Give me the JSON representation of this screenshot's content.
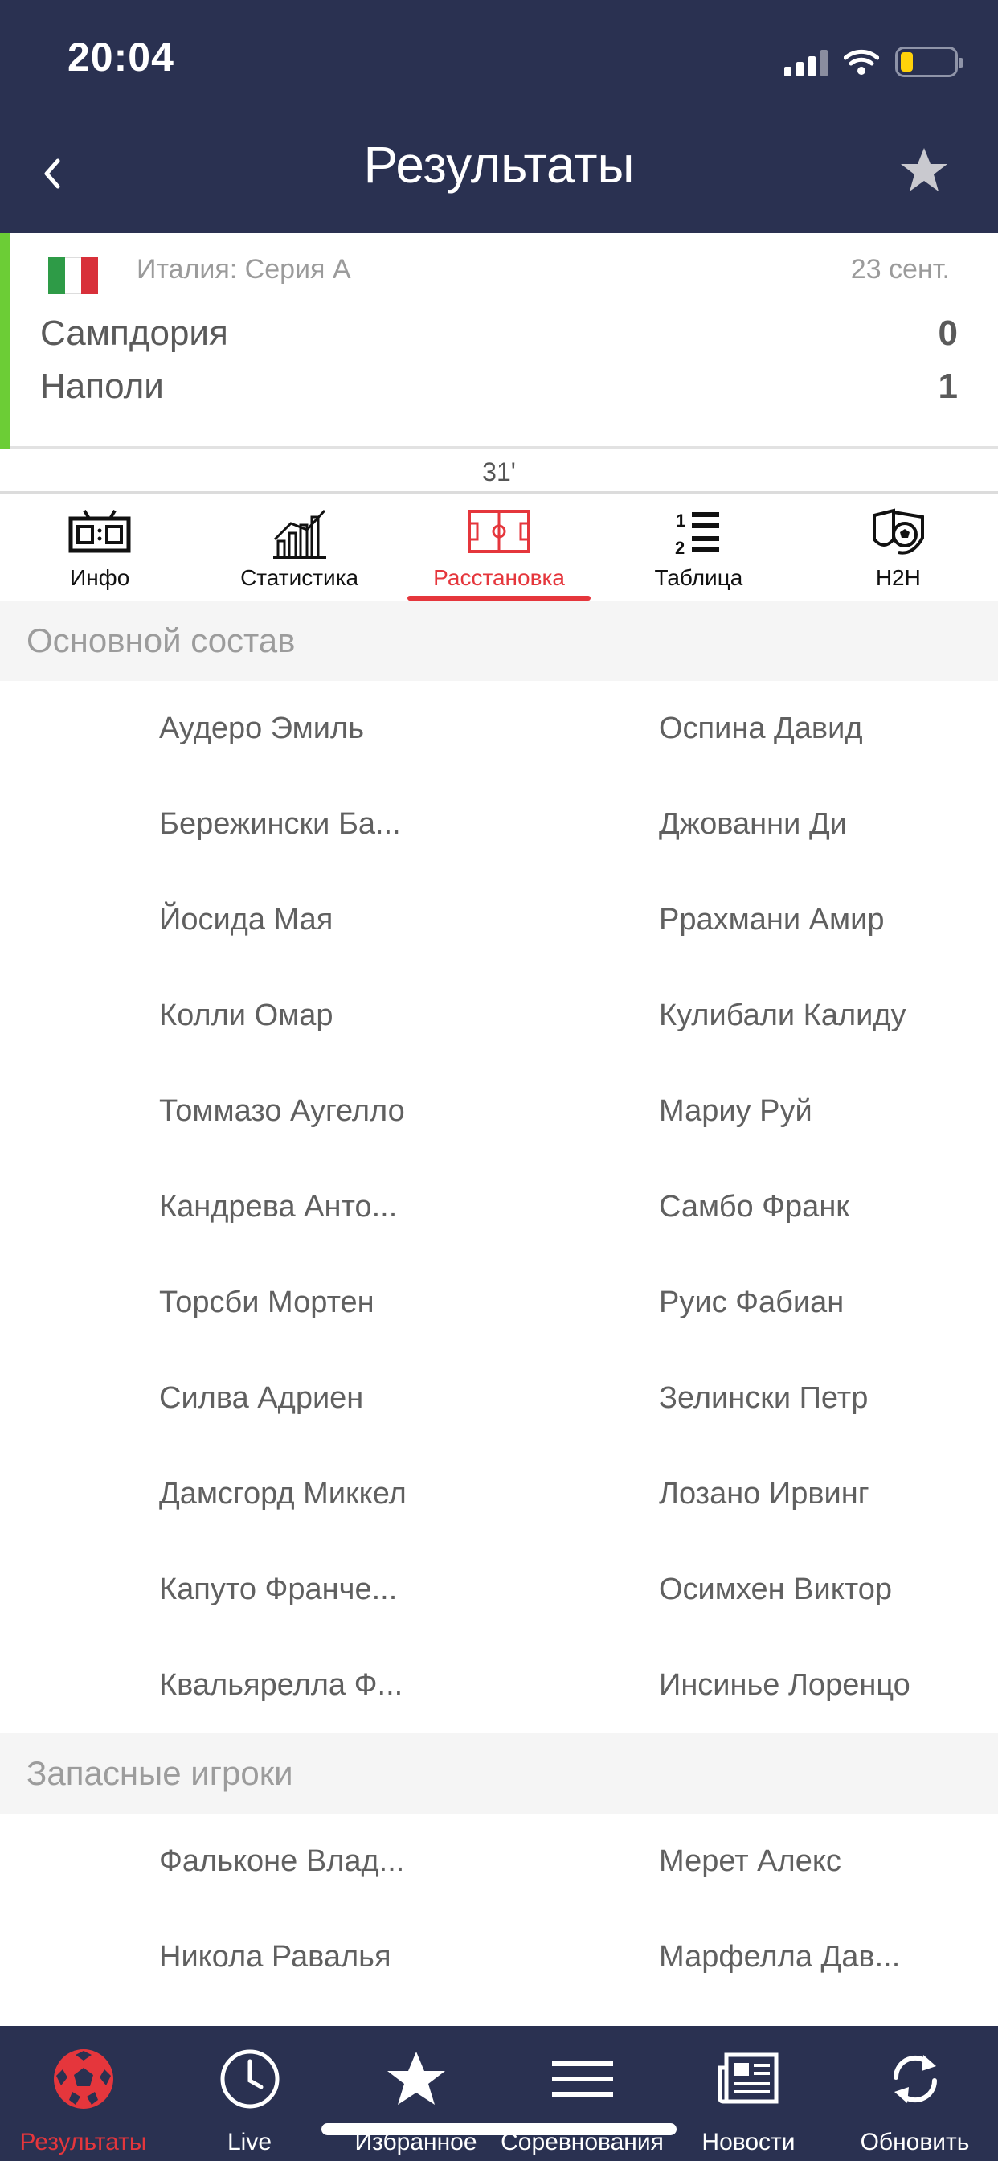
{
  "status_bar": {
    "time": "20:04"
  },
  "header": {
    "title": "Результаты"
  },
  "match": {
    "league": "Италия: Серия А",
    "date": "23 сент.",
    "home_team": "Сампдория",
    "away_team": "Наполи",
    "home_score": "0",
    "away_score": "1",
    "minute": "31'",
    "flag_colors": [
      "#2e9b47",
      "#ffffff",
      "#d8303a"
    ],
    "live_color": "#6ccd36"
  },
  "tabs": [
    {
      "label": "Инфо",
      "icon": "scoreboard-icon"
    },
    {
      "label": "Статистика",
      "icon": "stats-chart-icon"
    },
    {
      "label": "Расстановка",
      "icon": "field-lineup-icon",
      "active": true
    },
    {
      "label": "Таблица",
      "icon": "standings-list-icon"
    },
    {
      "label": "H2H",
      "icon": "h2h-shield-icon"
    }
  ],
  "lineups": {
    "starting_title": "Основной состав",
    "starting": [
      {
        "home": "Аудеро Эмиль",
        "away": "Оспина Давид"
      },
      {
        "home": "Бережински Ба...",
        "away": "Джованни Ди"
      },
      {
        "home": "Йосида Мая",
        "away": "Ррахмани Амир"
      },
      {
        "home": "Колли Омар",
        "away": "Кулибали Калиду"
      },
      {
        "home": "Томмазо Аугелло",
        "away": "Мариу Руй"
      },
      {
        "home": "Кандрева Анто...",
        "away": "Самбо Франк"
      },
      {
        "home": "Торсби Мортен",
        "away": "Руис Фабиан"
      },
      {
        "home": "Силва Адриен",
        "away": "Зелински Петр"
      },
      {
        "home": "Дамсгорд Миккел",
        "away": "Лозано Ирвинг"
      },
      {
        "home": "Капуто Франче...",
        "away": "Осимхен Виктор"
      },
      {
        "home": "Квальярелла Ф...",
        "away": "Инсинье Лоренцо"
      }
    ],
    "subs_title": "Запасные игроки",
    "subs": [
      {
        "home": "Фальконе Влад...",
        "away": "Мерет Алекс"
      },
      {
        "home": "Никола Равалья",
        "away": "Марфелла Дав..."
      }
    ]
  },
  "bottom_nav": [
    {
      "label": "Результаты",
      "icon": "soccer-ball-icon",
      "active": true
    },
    {
      "label": "Live",
      "icon": "clock-icon"
    },
    {
      "label": "Избранное",
      "icon": "star-icon"
    },
    {
      "label": "Соревнования",
      "icon": "menu-lines-icon"
    },
    {
      "label": "Новости",
      "icon": "newspaper-icon"
    },
    {
      "label": "Обновить",
      "icon": "refresh-icon"
    }
  ],
  "colors": {
    "header_bg": "#2a3151",
    "accent": "#e5363c",
    "section_bg": "#f5f5f5"
  }
}
